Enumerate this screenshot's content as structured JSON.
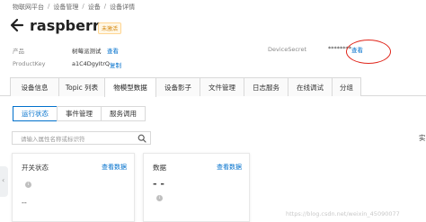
{
  "breadcrumb": [
    "物联网平台",
    "设备管理",
    "设备",
    "设备详情"
  ],
  "breadcrumb_sep": "/",
  "device": {
    "name": "raspberry",
    "status": "未激活",
    "product_label": "产品",
    "product_value": "树莓派测试",
    "product_link": "查看",
    "productkey_label": "ProductKey",
    "productkey_value": "a1C4DgyItrQ",
    "productkey_link": "复制",
    "secret_label": "DeviceSecret",
    "secret_value": "********",
    "secret_link": "查看"
  },
  "tabs": [
    "设备信息",
    "Topic 列表",
    "物模型数据",
    "设备影子",
    "文件管理",
    "日志服务",
    "在线调试",
    "分组"
  ],
  "active_tab": "物模型数据",
  "subtabs": [
    "运行状态",
    "事件管理",
    "服务调用"
  ],
  "active_subtab": "运行状态",
  "search_placeholder": "请输入属性名称或标识符",
  "right_cut_text": "实",
  "cards": [
    {
      "title": "开关状态",
      "link": "查看数据",
      "value": "--"
    },
    {
      "title": "数据",
      "link": "查看数据",
      "value": "- -"
    }
  ],
  "watermark": "https://blog.csdn.net/weixin_45090077",
  "colors": {
    "accent": "#0070cc",
    "badge": "#d4860b",
    "circle": "#e0261b"
  }
}
